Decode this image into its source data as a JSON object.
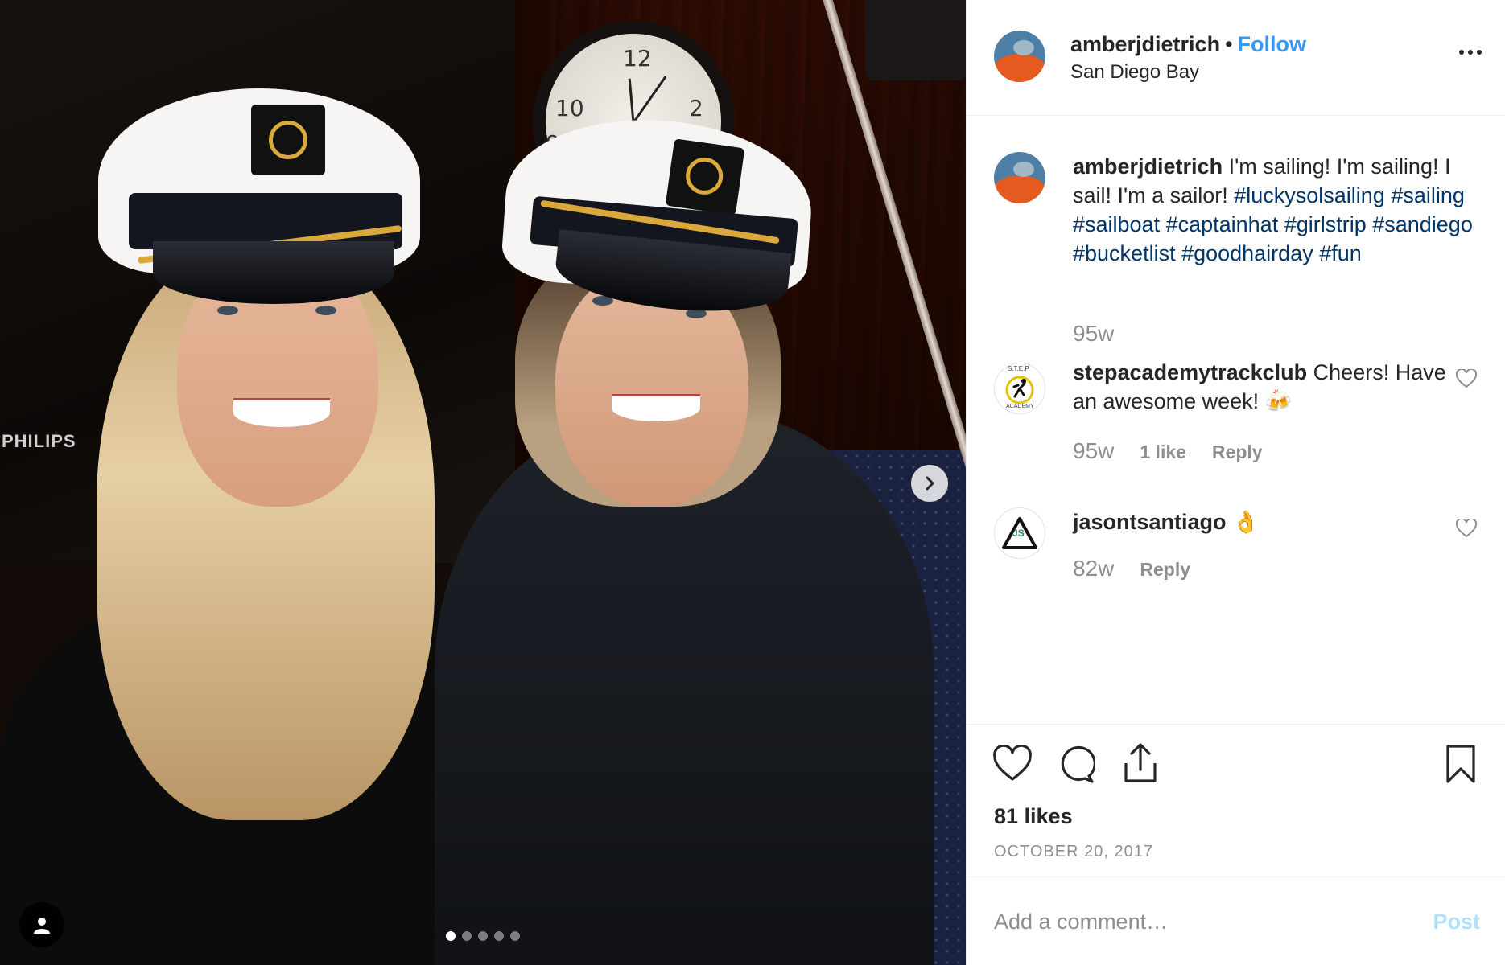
{
  "post": {
    "username": "amberjdietrich",
    "separator": "•",
    "follow_label": "Follow",
    "location": "San Diego Bay",
    "media": {
      "brand_text": "PHILIPS",
      "clock_numbers": [
        "12",
        "2",
        "10",
        "9"
      ],
      "carousel_count": 5,
      "carousel_active_index": 0
    },
    "caption": {
      "username": "amberjdietrich",
      "text": "I'm sailing! I'm sailing! I sail! I'm a sailor!",
      "hashtags": "#luckysolsailing #sailing #sailboat #captainhat #girlstrip #sandiego #bucketlist #goodhairday #fun",
      "time": "95w"
    },
    "comments": [
      {
        "username": "stepacademytrackclub",
        "text": "Cheers! Have an awesome week! 🍻",
        "time": "95w",
        "likes": "1 like",
        "reply": "Reply",
        "avatar_text_top": "S.T.E.P",
        "avatar_text_bottom": "ACADEMY"
      },
      {
        "username": "jasontsantiago",
        "text": "👌",
        "time": "82w",
        "reply": "Reply",
        "avatar_text": "JS"
      }
    ],
    "likes": "81 likes",
    "date": "OCTOBER 20, 2017",
    "comment_placeholder": "Add a comment…",
    "post_label": "Post",
    "icons": {
      "like": "heart-icon",
      "comment": "speech-bubble-icon",
      "share": "share-upload-icon",
      "save": "bookmark-icon",
      "more": "ellipsis-icon",
      "next": "chevron-right-icon",
      "tagged": "user-silhouette-icon"
    },
    "colors": {
      "link_blue": "#3897f0",
      "hashtag_blue": "#003569",
      "muted_gray": "#8e8e8e",
      "post_disabled": "#b2dffc"
    }
  }
}
